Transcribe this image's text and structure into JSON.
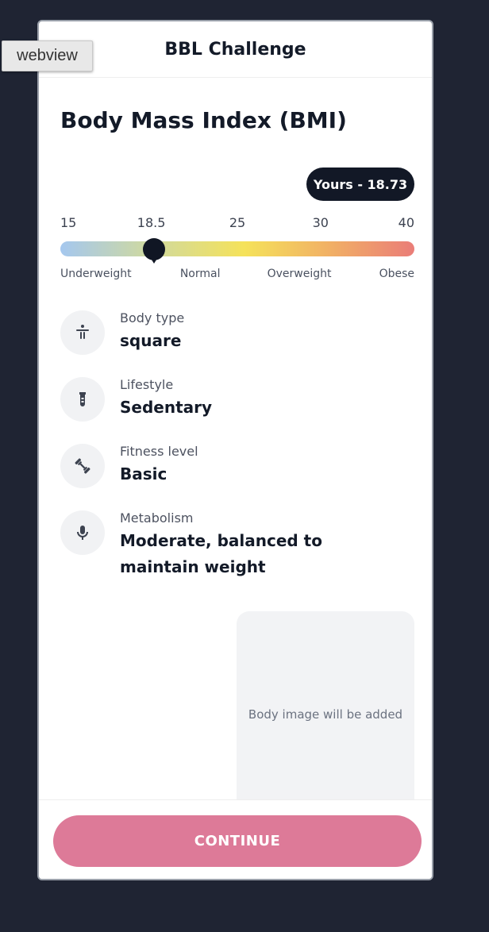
{
  "overlay": {
    "tag": "webview"
  },
  "header": {
    "title": "BBL Challenge"
  },
  "bmi": {
    "title": "Body Mass Index (BMI)",
    "yours_label": "Yours - 18.73",
    "value": 18.73,
    "scale": {
      "min": 15,
      "max": 40
    },
    "ticks": [
      "15",
      "18.5",
      "25",
      "30",
      "40"
    ],
    "categories": [
      "Underweight",
      "Normal",
      "Overweight",
      "Obese"
    ],
    "gradient_colors": [
      "#a4c7ef",
      "#cfd9a0",
      "#f5e25a",
      "#f1b065",
      "#ea7d78"
    ]
  },
  "details": [
    {
      "label": "Body type",
      "value": "square",
      "icon": "body-figure-icon"
    },
    {
      "label": "Lifestyle",
      "value": "Sedentary",
      "icon": "test-tube-icon"
    },
    {
      "label": "Fitness level",
      "value": "Basic",
      "icon": "dumbbell-icon"
    },
    {
      "label": "Metabolism",
      "value": "Moderate, balanced to maintain weight",
      "icon": "microphone-icon"
    }
  ],
  "body_image": {
    "placeholder": "Body image will be added"
  },
  "footer": {
    "continue_label": "CONTINUE",
    "button_color": "#dd7a98"
  }
}
